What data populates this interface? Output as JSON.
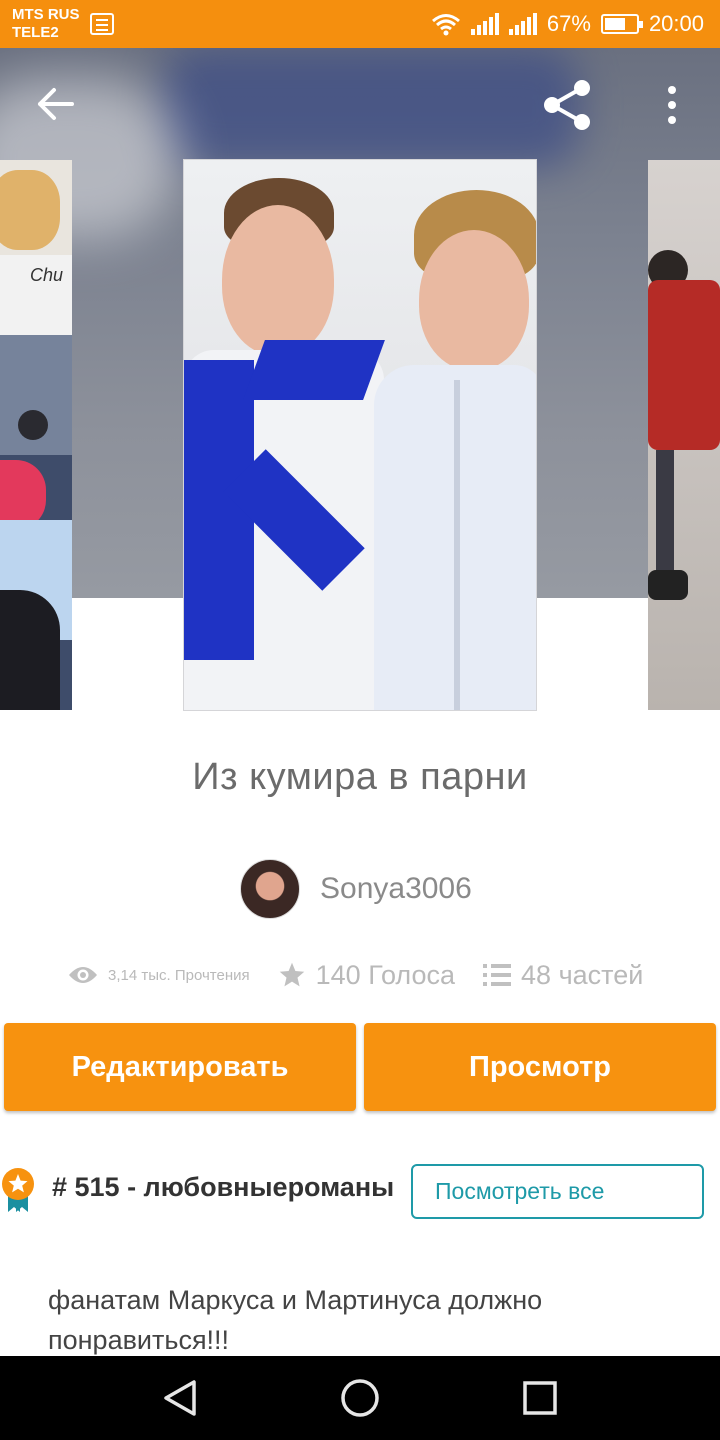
{
  "status_bar": {
    "carrier_1": "MTS RUS",
    "carrier_2": "TELE2",
    "battery": "67%",
    "battery_level": 0.67,
    "time": "20:00"
  },
  "header": {
    "back_icon": "arrow-left-icon",
    "share_icon": "share-icon",
    "more_icon": "more-vertical-icon"
  },
  "story": {
    "title": "Из кумира в парни",
    "author": "Sonya3006",
    "reads": "3,14 тыс. Прочтения",
    "votes": "140 Голоса",
    "parts": "48 частей"
  },
  "actions": {
    "edit_label": "Редактировать",
    "view_label": "Просмотр"
  },
  "ranking": {
    "text": "# 515 - любовныероманы",
    "see_all_label": "Посмотреть все"
  },
  "description": "фанатам Маркуса и Мартинуса должно понравиться!!!",
  "colors": {
    "accent": "#f7920f",
    "status_bar": "#f58f0e",
    "link": "#1e9aa8"
  }
}
